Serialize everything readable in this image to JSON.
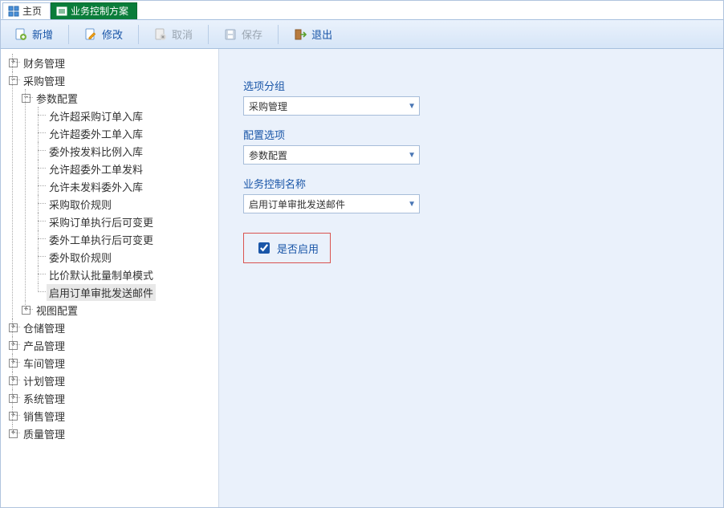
{
  "tabs": {
    "home": "主页",
    "active": "业务控制方案"
  },
  "toolbar": {
    "add": "新增",
    "edit": "修改",
    "cancel": "取消",
    "save": "保存",
    "exit": "退出"
  },
  "tree": {
    "n0": "财务管理",
    "n1": "采购管理",
    "n1_0": "参数配置",
    "n1_0_0": "允许超采购订单入库",
    "n1_0_1": "允许超委外工单入库",
    "n1_0_2": "委外按发料比例入库",
    "n1_0_3": "允许超委外工单发料",
    "n1_0_4": "允许未发料委外入库",
    "n1_0_5": "采购取价规则",
    "n1_0_6": "采购订单执行后可变更",
    "n1_0_7": "委外工单执行后可变更",
    "n1_0_8": "委外取价规则",
    "n1_0_9": "比价默认批量制单模式",
    "n1_0_10": "启用订单审批发送邮件",
    "n1_1": "视图配置",
    "n2": "仓储管理",
    "n3": "产品管理",
    "n4": "车间管理",
    "n5": "计划管理",
    "n6": "系统管理",
    "n7": "销售管理",
    "n8": "质量管理"
  },
  "form": {
    "group_label": "选项分组",
    "group_value": "采购管理",
    "option_label": "配置选项",
    "option_value": "参数配置",
    "name_label": "业务控制名称",
    "name_value": "启用订单审批发送邮件",
    "enabled_label": "是否启用"
  }
}
